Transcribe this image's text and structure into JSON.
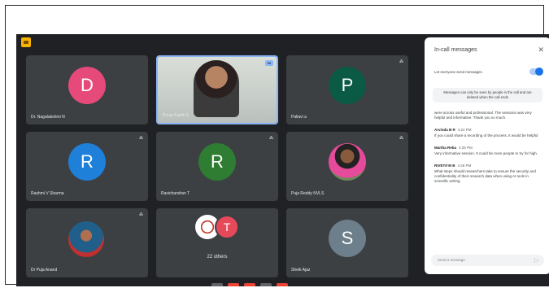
{
  "window": {
    "title": "Google Meet"
  },
  "participants": [
    {
      "id": "p1",
      "name": "Dr. Nagalakshmi N",
      "initial": "D",
      "color": "#e64a7a",
      "type": "avatar"
    },
    {
      "id": "p2",
      "name": "Pooja Kanth S",
      "type": "video",
      "active": true
    },
    {
      "id": "p3",
      "name": "Pallavi a",
      "initial": "P",
      "color": "#0b5a45",
      "type": "avatar"
    },
    {
      "id": "p4",
      "name": "Rashmi V Sharma",
      "initial": "R",
      "color": "#1e80d9",
      "type": "avatar"
    },
    {
      "id": "p5",
      "name": "Ravichandran T",
      "initial": "R",
      "color": "#2e7d32",
      "type": "avatar"
    },
    {
      "id": "p6",
      "name": "Puja Reddy NVLS",
      "type": "photo"
    },
    {
      "id": "p7",
      "name": "Dr Puja Anand",
      "type": "photo"
    },
    {
      "id": "p8",
      "name": "22 others",
      "initial": "T",
      "color": "#e64a5a",
      "type": "group"
    },
    {
      "id": "p9",
      "name": "Sheik Ajaz",
      "initial": "S",
      "color": "#6c7f8a",
      "type": "avatar"
    }
  ],
  "chat": {
    "title": "In-call messages",
    "toggle_label": "Let everyone send messages",
    "notice": "Messages can only be seen by people in the call and are deleted when the call ends",
    "messages": [
      {
        "author": "",
        "time": "",
        "text": "were across useful and professional. The sessions was very helpful and informative. Thank you so much."
      },
      {
        "author": "Arvinda B R",
        "time": "4:24 PM",
        "text": "If you could share a recording of the process, it would be helpful"
      },
      {
        "author": "Martha Reba",
        "time": "4:25 PM",
        "text": "Very informative session. It could be more people to try for high."
      },
      {
        "author": "RIVETA'M B",
        "time": "4:26 PM",
        "text": "What steps should researchers take to ensure the security and confidentiality of their research data when using AI tools in scientific writing"
      }
    ],
    "compose_placeholder": "Send a message"
  }
}
